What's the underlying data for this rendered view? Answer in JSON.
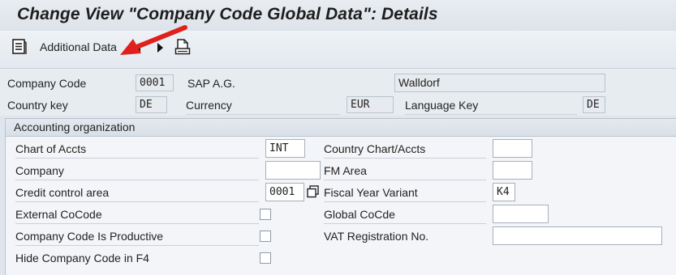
{
  "title": "Change View \"Company Code Global Data\": Details",
  "toolbar": {
    "additional_data_label": "Additional Data",
    "icons": [
      "details-list-icon",
      "previous-arrow-icon",
      "next-arrow-icon",
      "print-icon"
    ]
  },
  "header": {
    "company_code_label": "Company Code",
    "company_code_value": "0001",
    "company_name": "SAP A.G.",
    "city": "Walldorf",
    "country_key_label": "Country key",
    "country_key_value": "DE",
    "currency_label": "Currency",
    "currency_value": "EUR",
    "language_key_label": "Language Key",
    "language_key_value": "DE"
  },
  "accounting": {
    "group_title": "Accounting organization",
    "chart_of_accts_label": "Chart of Accts",
    "chart_of_accts_value": "INT",
    "company_label": "Company",
    "company_value": "",
    "credit_control_label": "Credit control area",
    "credit_control_value": "0001",
    "external_cocode_label": "External CoCode",
    "external_cocode_checked": false,
    "productive_label": "Company Code Is Productive",
    "productive_checked": false,
    "hide_f4_label": "Hide Company Code in F4",
    "hide_f4_checked": false,
    "country_chart_label": "Country Chart/Accts",
    "country_chart_value": "",
    "fm_area_label": "FM Area",
    "fm_area_value": "",
    "fiscal_year_variant_label": "Fiscal Year Variant",
    "fiscal_year_variant_value": "K4",
    "global_cocde_label": "Global CoCde",
    "global_cocde_value": "",
    "vat_reg_label": "VAT Registration No.",
    "vat_reg_value": ""
  },
  "colors": {
    "annotation_arrow": "#e0201c"
  }
}
